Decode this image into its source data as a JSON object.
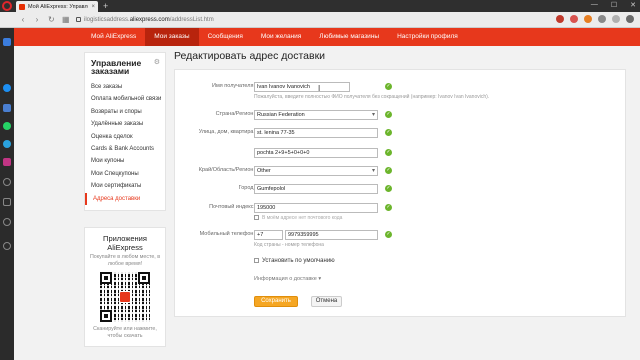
{
  "browser": {
    "tab_title": "Мой AliExpress: Управле...",
    "tab_close": "×",
    "new_tab": "+",
    "url_prefix": "ilogisticsaddress.",
    "url_domain": "aliexpress.com",
    "url_path": "/addressList.htm",
    "window_controls": [
      "—",
      "☐",
      "✕"
    ],
    "ext_colors": [
      "#c0392b",
      "#d9534f",
      "#e67e22",
      "#888888",
      "#b0b0b0",
      "#6a6a6a"
    ]
  },
  "topnav": {
    "items": [
      {
        "label": "Мой AliExpress"
      },
      {
        "label": "Мои заказы"
      },
      {
        "label": "Сообщения"
      },
      {
        "label": "Мои желания"
      },
      {
        "label": "Любимые магазины"
      },
      {
        "label": "Настройки профиля"
      }
    ],
    "active_index": 1
  },
  "menu": {
    "title": "Управление заказами",
    "items": [
      "Все заказы",
      "Оплата мобильной связи",
      "Возвраты и споры",
      "Удалённые заказы",
      "Оценка сделок",
      "Cards & Bank Accounts",
      "Мои купоны",
      "Мои Спецкупоны",
      "Мои сертификаты",
      "Адреса доставки"
    ],
    "active_item": "Адреса доставки"
  },
  "app_promo": {
    "title": "Приложения AliExpress",
    "subtitle": "Покупайте в любом месте, в любое время!",
    "scan_text": "Сканируйте или нажмите, чтобы скачать"
  },
  "form": {
    "title": "Редактировать адрес доставки",
    "recipient": {
      "label": "Имя получателя:",
      "value": "Ivan Ivanov Ivanovich",
      "hint": "Пожалуйста, введите полностью ФИО получателя без сокращений (например: Ivanov Ivan Ivanovich)."
    },
    "country": {
      "label": "Страна/Регион:",
      "value": "Russian Federation"
    },
    "street": {
      "label": "Улица, дом, квартира:",
      "value": "st. lenina 77-35"
    },
    "street2": {
      "value": "pochta 2+9+5+0+0+0"
    },
    "region": {
      "label": "Край/Область/Регион:",
      "value": "Other"
    },
    "city": {
      "label": "Город:",
      "value": "Gumfepolol"
    },
    "zip": {
      "label": "Почтовый индекс:",
      "value": "195000",
      "no_zip_label": "В моём адресе нет почтового кода"
    },
    "phone": {
      "label": "Мобильный телефон:",
      "code": "+7",
      "number": "9979359995",
      "hint": "Код страны - номер телефона"
    },
    "default_label": "Установить по умолчанию",
    "more_info": "Информация о доставке",
    "save": "Сохранить",
    "cancel": "Отмена"
  }
}
